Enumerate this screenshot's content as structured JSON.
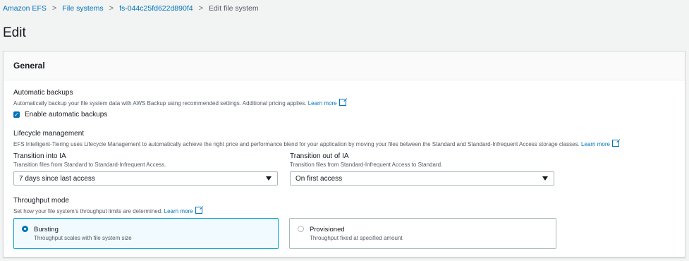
{
  "breadcrumb": {
    "items": [
      "Amazon EFS",
      "File systems",
      "fs-044c25fd622d890f4"
    ],
    "current": "Edit file system"
  },
  "page_title": "Edit",
  "panel": {
    "title": "General",
    "backups": {
      "label": "Automatic backups",
      "desc": "Automatically backup your file system data with AWS Backup using recommended settings. Additional pricing applies.",
      "learn_more": "Learn more",
      "checkbox_label": "Enable automatic backups",
      "checked": true
    },
    "lifecycle": {
      "label": "Lifecycle management",
      "desc": "EFS Intelligent-Tiering uses Lifecycle Management to automatically achieve the right price and performance blend for your application by moving your files between the Standard and Standard-Infrequent Access storage classes.",
      "learn_more": "Learn more",
      "into_ia": {
        "label": "Transition into IA",
        "desc": "Transition files from Standard to Standard-Infrequent Access.",
        "value": "7 days since last access"
      },
      "out_of_ia": {
        "label": "Transition out of IA",
        "desc": "Transition files from Standard-Infrequent Access to Standard.",
        "value": "On first access"
      }
    },
    "throughput": {
      "label": "Throughput mode",
      "desc": "Set how your file system's throughput limits are determined.",
      "learn_more": "Learn more",
      "options": [
        {
          "title": "Bursting",
          "desc": "Throughput scales with file system size",
          "selected": true
        },
        {
          "title": "Provisioned",
          "desc": "Throughput fixed at specified amount",
          "selected": false
        }
      ]
    }
  },
  "colors": {
    "link": "#0073bb",
    "selected_tile_bg": "#f1faff",
    "selected_tile_border": "#00a1c9"
  }
}
